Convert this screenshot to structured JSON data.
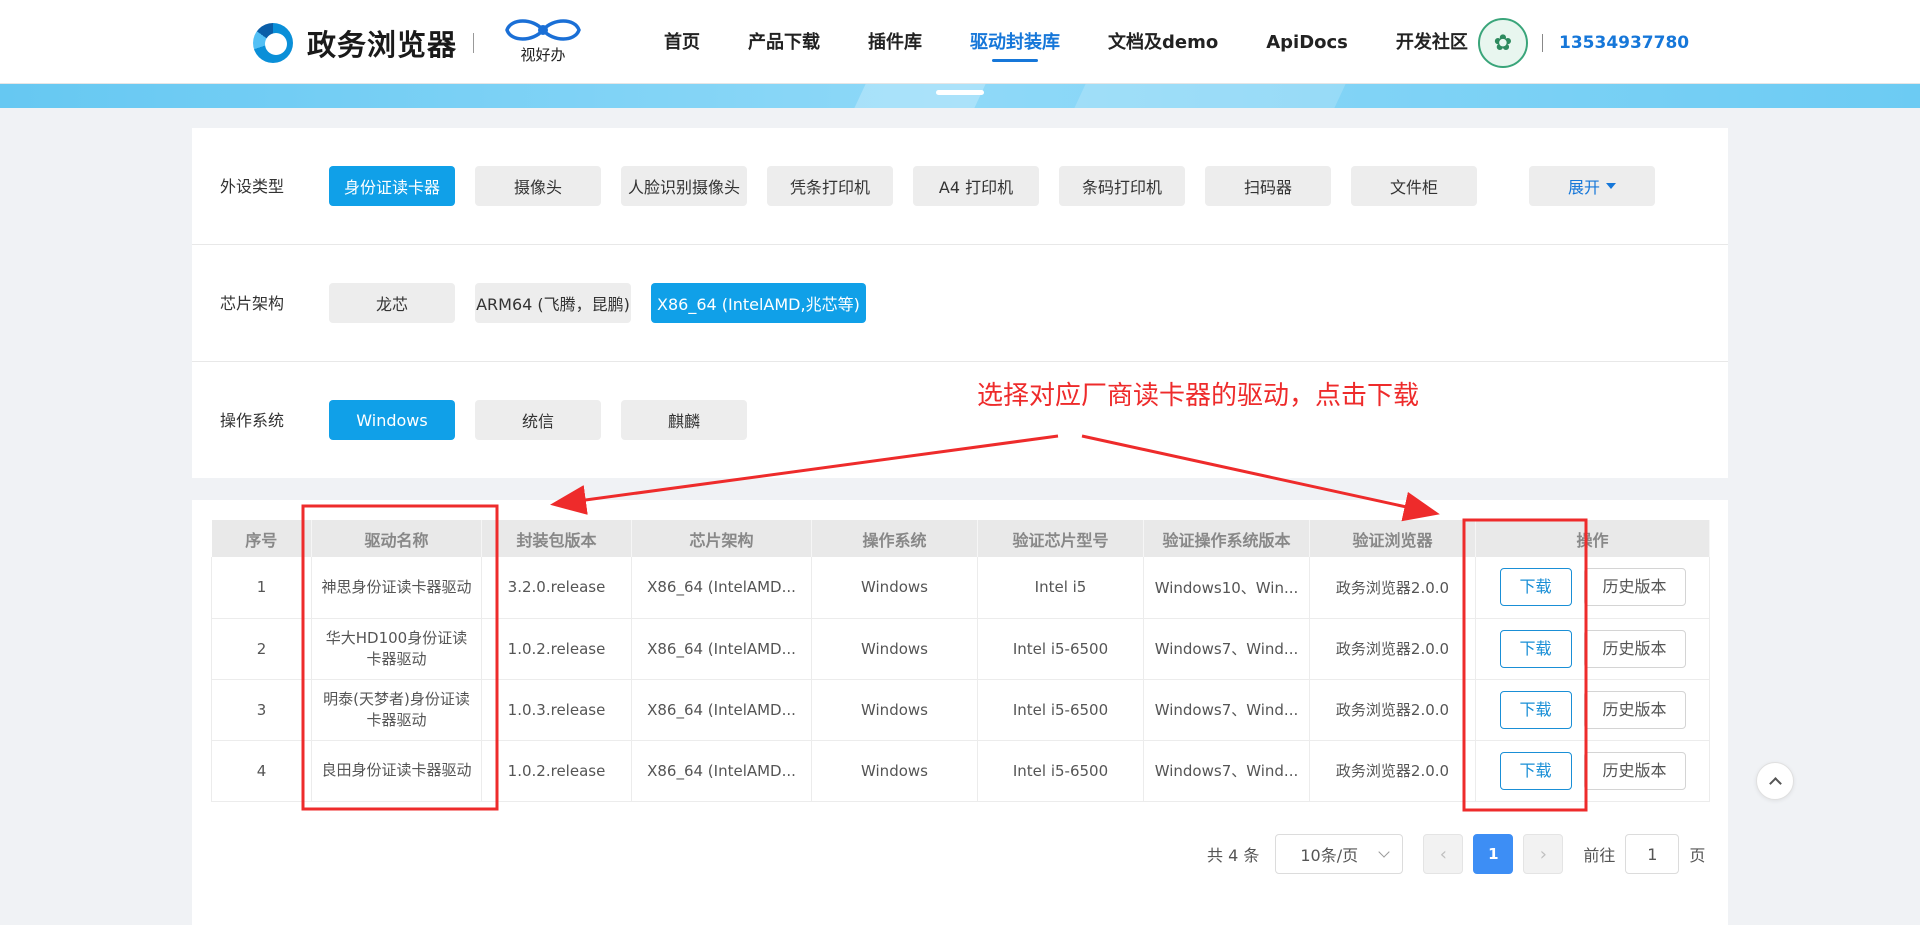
{
  "header": {
    "logo_text": "政务浏览器",
    "partner_text": "视好办",
    "nav": [
      {
        "label": "首页",
        "active": false
      },
      {
        "label": "产品下载",
        "active": false
      },
      {
        "label": "插件库",
        "active": false
      },
      {
        "label": "驱动封装库",
        "active": true
      },
      {
        "label": "文档及demo",
        "active": false
      },
      {
        "label": "ApiDocs",
        "active": false
      },
      {
        "label": "开发社区",
        "active": false
      }
    ],
    "user_phone": "13534937780"
  },
  "filters": {
    "peripheral": {
      "label": "外设类型",
      "options": [
        {
          "label": "身份证读卡器",
          "selected": true
        },
        {
          "label": "摄像头",
          "selected": false
        },
        {
          "label": "人脸识别摄像头",
          "selected": false
        },
        {
          "label": "凭条打印机",
          "selected": false
        },
        {
          "label": "A4 打印机",
          "selected": false
        },
        {
          "label": "条码打印机",
          "selected": false
        },
        {
          "label": "扫码器",
          "selected": false
        },
        {
          "label": "文件柜",
          "selected": false
        }
      ],
      "expand_label": "展开"
    },
    "chip_arch": {
      "label": "芯片架构",
      "options": [
        {
          "label": "龙芯",
          "selected": false
        },
        {
          "label": "ARM64 (飞腾，昆鹏)",
          "selected": false
        },
        {
          "label": "X86_64 (IntelAMD,兆芯等)",
          "selected": true
        }
      ]
    },
    "os": {
      "label": "操作系统",
      "options": [
        {
          "label": "Windows",
          "selected": true
        },
        {
          "label": "统信",
          "selected": false
        },
        {
          "label": "麒麟",
          "selected": false
        }
      ]
    }
  },
  "annotation": {
    "text": "选择对应厂商读卡器的驱动，点击下载",
    "color": "#ee2b2b"
  },
  "table": {
    "headers": [
      "序号",
      "驱动名称",
      "封装包版本",
      "芯片架构",
      "操作系统",
      "验证芯片型号",
      "验证操作系统版本",
      "验证浏览器",
      "操作"
    ],
    "rows": [
      {
        "index": "1",
        "name": "神思身份证读卡器驱动",
        "version": "3.2.0.release",
        "arch": "X86_64 (IntelAMD...",
        "os": "Windows",
        "chip": "Intel i5",
        "os_version": "Windows10、Win...",
        "browser": "政务浏览器2.0.0"
      },
      {
        "index": "2",
        "name": "华大HD100身份证读卡器驱动",
        "version": "1.0.2.release",
        "arch": "X86_64 (IntelAMD...",
        "os": "Windows",
        "chip": "Intel i5-6500",
        "os_version": "Windows7、Wind...",
        "browser": "政务浏览器2.0.0"
      },
      {
        "index": "3",
        "name": "明泰(天梦者)身份证读卡器驱动",
        "version": "1.0.3.release",
        "arch": "X86_64 (IntelAMD...",
        "os": "Windows",
        "chip": "Intel i5-6500",
        "os_version": "Windows7、Wind...",
        "browser": "政务浏览器2.0.0"
      },
      {
        "index": "4",
        "name": "良田身份证读卡器驱动",
        "version": "1.0.2.release",
        "arch": "X86_64 (IntelAMD...",
        "os": "Windows",
        "chip": "Intel i5-6500",
        "os_version": "Windows7、Wind...",
        "browser": "政务浏览器2.0.0"
      }
    ],
    "download_label": "下载",
    "history_label": "历史版本"
  },
  "pagination": {
    "total_text": "共 4 条",
    "page_size": "10条/页",
    "prev_icon": "‹",
    "current_page": "1",
    "next_icon": "›",
    "goto_label": "前往",
    "goto_value": "1",
    "page_suffix": "页"
  },
  "colors": {
    "accent": "#10a0e8",
    "nav_active": "#1677d9",
    "annotation": "#ee2b2b"
  }
}
